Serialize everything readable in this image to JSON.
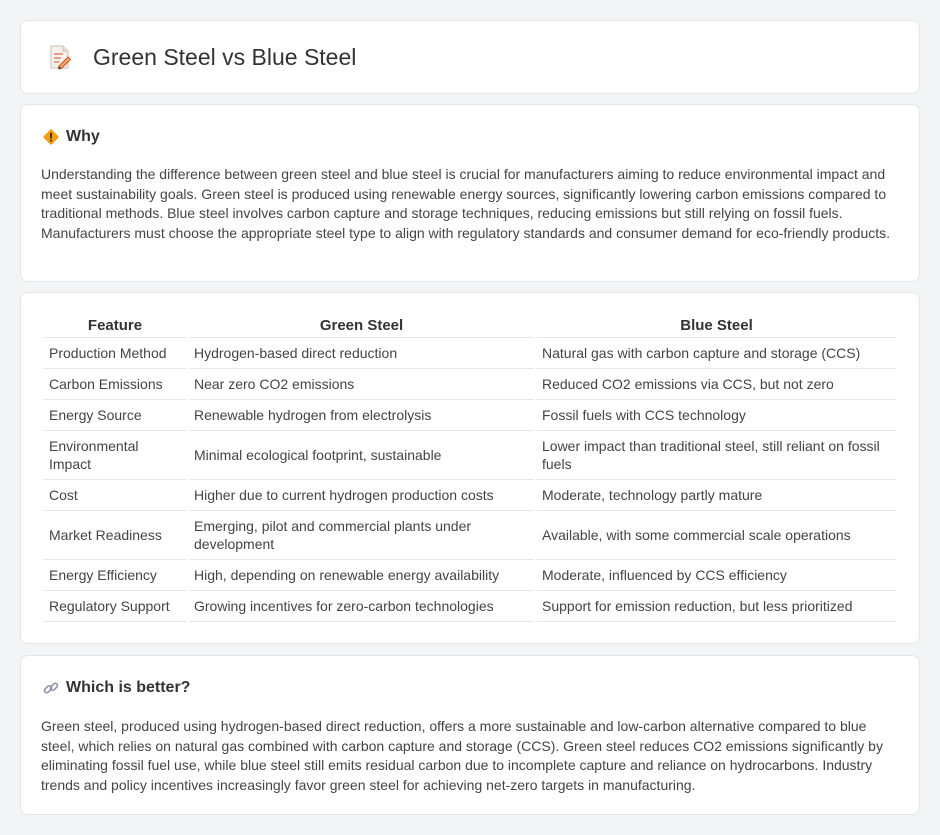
{
  "header": {
    "title": "Green Steel vs Blue Steel",
    "icon": "document-pencil-icon"
  },
  "why": {
    "title": "Why",
    "icon": "diamond-warning-icon",
    "text": "Understanding the difference between green steel and blue steel is crucial for manufacturers aiming to reduce environmental impact and meet sustainability goals. Green steel is produced using renewable energy sources, significantly lowering carbon emissions compared to traditional methods. Blue steel involves carbon capture and storage techniques, reducing emissions but still relying on fossil fuels. Manufacturers must choose the appropriate steel type to align with regulatory standards and consumer demand for eco-friendly products."
  },
  "table": {
    "headers": [
      "Feature",
      "Green Steel",
      "Blue Steel"
    ],
    "rows": [
      [
        "Production Method",
        "Hydrogen-based direct reduction",
        "Natural gas with carbon capture and storage (CCS)"
      ],
      [
        "Carbon Emissions",
        "Near zero CO2 emissions",
        "Reduced CO2 emissions via CCS, but not zero"
      ],
      [
        "Energy Source",
        "Renewable hydrogen from electrolysis",
        "Fossil fuels with CCS technology"
      ],
      [
        "Environmental Impact",
        "Minimal ecological footprint, sustainable",
        "Lower impact than traditional steel, still reliant on fossil fuels"
      ],
      [
        "Cost",
        "Higher due to current hydrogen production costs",
        "Moderate, technology partly mature"
      ],
      [
        "Market Readiness",
        "Emerging, pilot and commercial plants under development",
        "Available, with some commercial scale operations"
      ],
      [
        "Energy Efficiency",
        "High, depending on renewable energy availability",
        "Moderate, influenced by CCS efficiency"
      ],
      [
        "Regulatory Support",
        "Growing incentives for zero-carbon technologies",
        "Support for emission reduction, but less prioritized"
      ]
    ]
  },
  "better": {
    "title": "Which is better?",
    "icon": "link-icon",
    "text": "Green steel, produced using hydrogen-based direct reduction, offers a more sustainable and low-carbon alternative compared to blue steel, which relies on natural gas combined with carbon capture and storage (CCS). Green steel reduces CO2 emissions significantly by eliminating fossil fuel use, while blue steel still emits residual carbon due to incomplete capture and reliance on hydrocarbons. Industry trends and policy incentives increasingly favor green steel for achieving net-zero targets in manufacturing."
  }
}
